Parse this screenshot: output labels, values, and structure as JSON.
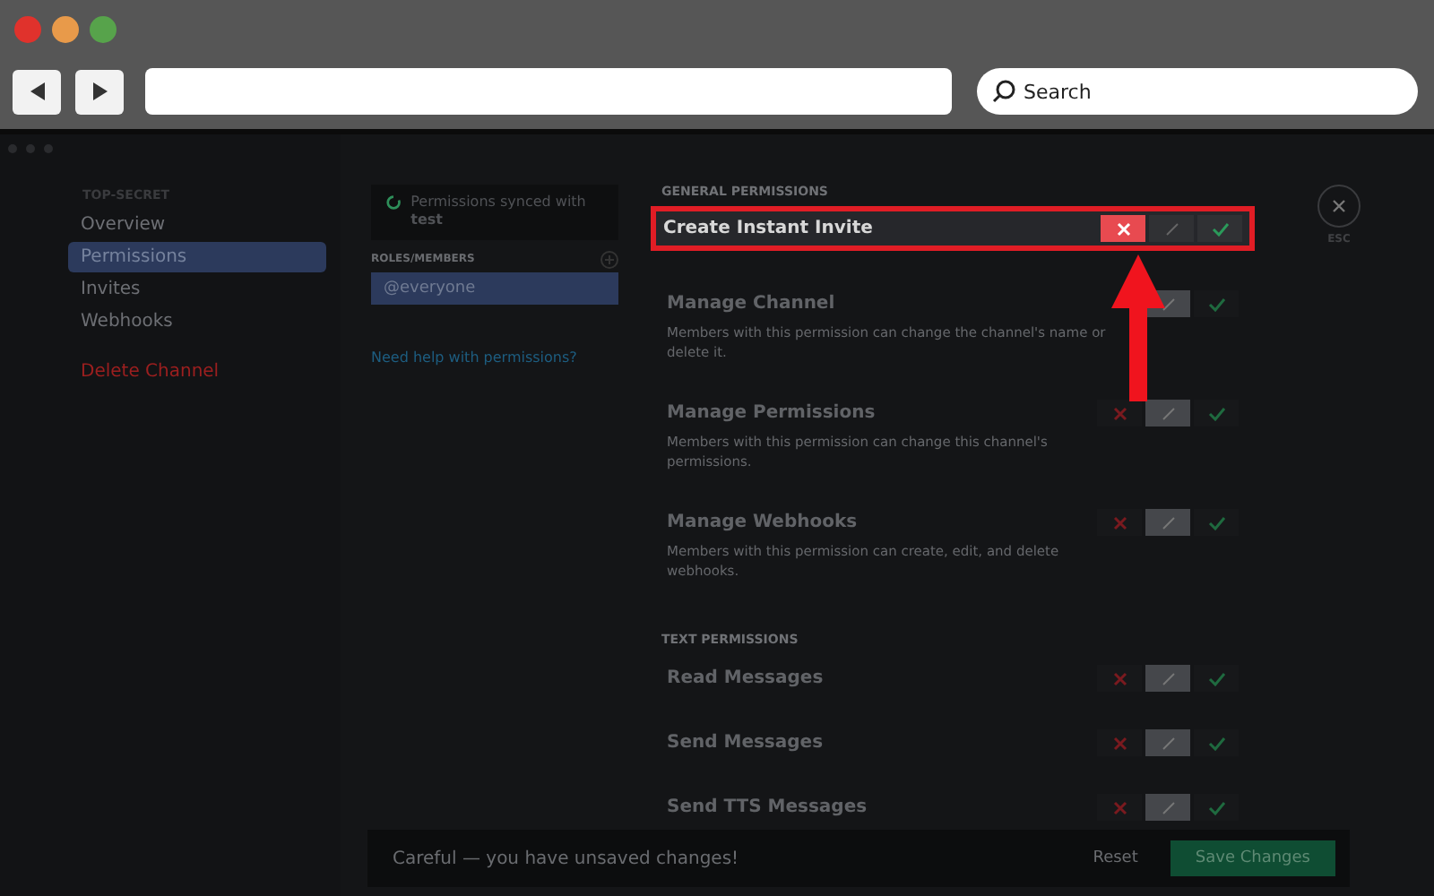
{
  "browser": {
    "search": {
      "placeholder": "Search"
    }
  },
  "sidebar": {
    "header": "TOP-SECRET",
    "items": [
      {
        "label": "Overview",
        "selected": false,
        "kind": "nav"
      },
      {
        "label": "Permissions",
        "selected": true,
        "kind": "nav"
      },
      {
        "label": "Invites",
        "selected": false,
        "kind": "nav"
      },
      {
        "label": "Webhooks",
        "selected": false,
        "kind": "nav"
      },
      {
        "label": "Delete Channel",
        "selected": false,
        "kind": "danger"
      }
    ]
  },
  "roles": {
    "sync_notice": "Permissions synced with **test**",
    "header": "ROLES/MEMBERS",
    "items": [
      {
        "label": "@everyone",
        "selected": true
      }
    ],
    "help_link": "Need help with permissions?"
  },
  "sections": [
    {
      "title": "GENERAL PERMISSIONS",
      "permissions": [
        {
          "name": "Create Instant Invite",
          "highlighted": true,
          "toggles": [
            {
              "kind": "deny",
              "selected": true
            },
            {
              "kind": "neutral",
              "selected": false
            },
            {
              "kind": "allow",
              "selected": false
            }
          ]
        },
        {
          "name": "Manage Channel",
          "description": "Members with this permission can change the channel's name or delete it.",
          "highlighted": false,
          "toggles": [
            {
              "kind": "neutral",
              "selected": true
            },
            {
              "kind": "allow",
              "selected": false
            }
          ]
        },
        {
          "name": "Manage Permissions",
          "description": "Members with this permission can change this channel's permissions.",
          "highlighted": false,
          "toggles": [
            {
              "kind": "deny",
              "selected": false
            },
            {
              "kind": "neutral",
              "selected": true
            },
            {
              "kind": "allow",
              "selected": false
            }
          ]
        },
        {
          "name": "Manage Webhooks",
          "description": "Members with this permission can create, edit, and delete webhooks.",
          "highlighted": false,
          "toggles": [
            {
              "kind": "deny",
              "selected": false
            },
            {
              "kind": "neutral",
              "selected": true
            },
            {
              "kind": "allow",
              "selected": false
            }
          ]
        }
      ]
    },
    {
      "title": "TEXT PERMISSIONS",
      "permissions": [
        {
          "name": "Read Messages",
          "highlighted": false,
          "toggles": [
            {
              "kind": "deny",
              "selected": false
            },
            {
              "kind": "neutral",
              "selected": true
            },
            {
              "kind": "allow",
              "selected": false
            }
          ]
        },
        {
          "name": "Send Messages",
          "highlighted": false,
          "toggles": [
            {
              "kind": "deny",
              "selected": false
            },
            {
              "kind": "neutral",
              "selected": true
            },
            {
              "kind": "allow",
              "selected": false
            }
          ]
        },
        {
          "name": "Send TTS Messages",
          "highlighted": false,
          "toggles": [
            {
              "kind": "deny",
              "selected": false
            },
            {
              "kind": "neutral",
              "selected": true
            },
            {
              "kind": "allow",
              "selected": false
            }
          ]
        }
      ]
    }
  ],
  "close": {
    "label": "ESC"
  },
  "unsaved_bar": {
    "message": "Careful — you have unsaved changes!",
    "reset": "Reset",
    "save": "Save Changes"
  }
}
